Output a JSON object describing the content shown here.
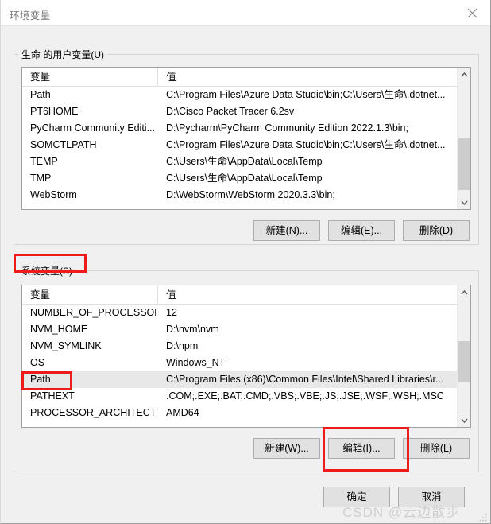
{
  "window": {
    "title": "环境变量",
    "close_icon": "close-icon"
  },
  "user_section": {
    "label": "生命 的用户变量(U)",
    "columns": [
      "变量",
      "值"
    ],
    "rows": [
      {
        "name": "Path",
        "value": "C:\\Program Files\\Azure Data Studio\\bin;C:\\Users\\生命\\.dotnet..."
      },
      {
        "name": "PT6HOME",
        "value": "D:\\Cisco Packet Tracer 6.2sv"
      },
      {
        "name": "PyCharm Community Editi...",
        "value": "D:\\Pycharm\\PyCharm Community Edition 2022.1.3\\bin;"
      },
      {
        "name": "SOMCTLPATH",
        "value": "C:\\Program Files\\Azure Data Studio\\bin;C:\\Users\\生命\\.dotnet..."
      },
      {
        "name": "TEMP",
        "value": "C:\\Users\\生命\\AppData\\Local\\Temp"
      },
      {
        "name": "TMP",
        "value": "C:\\Users\\生命\\AppData\\Local\\Temp"
      },
      {
        "name": "WebStorm",
        "value": "D:\\WebStorm\\WebStorm 2020.3.3\\bin;"
      }
    ],
    "buttons": {
      "new": "新建(N)...",
      "edit": "编辑(E)...",
      "delete": "删除(D)"
    }
  },
  "system_section": {
    "label": "系统变量(S)",
    "columns": [
      "变量",
      "值"
    ],
    "rows": [
      {
        "name": "NUMBER_OF_PROCESSORS",
        "value": "12",
        "selected": false
      },
      {
        "name": "NVM_HOME",
        "value": "D:\\nvm\\nvm",
        "selected": false
      },
      {
        "name": "NVM_SYMLINK",
        "value": "D:\\npm",
        "selected": false
      },
      {
        "name": "OS",
        "value": "Windows_NT",
        "selected": false
      },
      {
        "name": "Path",
        "value": "C:\\Program Files (x86)\\Common Files\\Intel\\Shared Libraries\\r...",
        "selected": true
      },
      {
        "name": "PATHEXT",
        "value": ".COM;.EXE;.BAT;.CMD;.VBS;.VBE;.JS;.JSE;.WSF;.WSH;.MSC",
        "selected": false
      },
      {
        "name": "PROCESSOR_ARCHITECT...",
        "value": "AMD64",
        "selected": false
      }
    ],
    "buttons": {
      "new": "新建(W)...",
      "edit": "编辑(I)...",
      "delete": "删除(L)"
    }
  },
  "dialog_buttons": {
    "ok": "确定",
    "cancel": "取消"
  },
  "annotations": {
    "color": "#ee1b1b",
    "boxes": [
      "system-variables-label",
      "system-path-row-name",
      "system-edit-button"
    ]
  },
  "watermark": {
    "text": "CSDN @云边散步"
  },
  "scrollbars": {
    "up_arrow": "chevron-up-icon",
    "down_arrow": "chevron-down-icon"
  }
}
